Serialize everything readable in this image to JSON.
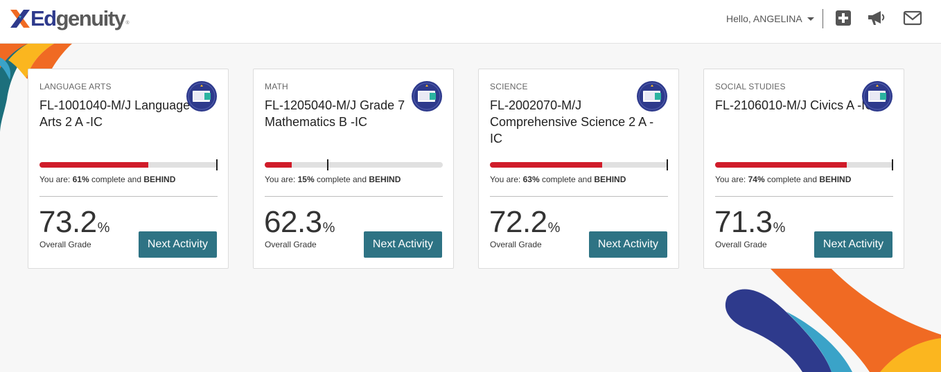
{
  "header": {
    "logo_text_ed": "Ed",
    "logo_text_rest": "genuity",
    "greeting": "Hello, ANGELINA",
    "icons": [
      "plus-square-icon",
      "megaphone-icon",
      "envelope-icon"
    ]
  },
  "colors": {
    "accent": "#2e7384",
    "progress_fill": "#d01c2a",
    "progress_track": "#e0e0e0",
    "badge": "#2e3a8c"
  },
  "courses": [
    {
      "subject": "LANGUAGE ARTS",
      "title": "FL-1001040-M/J Language Arts 2 A -IC",
      "progress_percent": 61,
      "target_percent": 100,
      "status_prefix": "You are: ",
      "status_percent": "61%",
      "status_mid": " complete and ",
      "status_state": "BEHIND",
      "grade": "73.2",
      "grade_unit": "%",
      "grade_label": "Overall Grade",
      "button_label": "Next Activity"
    },
    {
      "subject": "MATH",
      "title": "FL-1205040-M/J Grade 7 Mathematics B -IC",
      "progress_percent": 15,
      "target_percent": 35,
      "status_prefix": "You are: ",
      "status_percent": "15%",
      "status_mid": " complete and ",
      "status_state": "BEHIND",
      "grade": "62.3",
      "grade_unit": "%",
      "grade_label": "Overall Grade",
      "button_label": "Next Activity"
    },
    {
      "subject": "SCIENCE",
      "title": "FL-2002070-M/J Comprehensive Science 2 A -IC",
      "progress_percent": 63,
      "target_percent": 100,
      "status_prefix": "You are: ",
      "status_percent": "63%",
      "status_mid": " complete and ",
      "status_state": "BEHIND",
      "grade": "72.2",
      "grade_unit": "%",
      "grade_label": "Overall Grade",
      "button_label": "Next Activity"
    },
    {
      "subject": "SOCIAL STUDIES",
      "title": "FL-2106010-M/J Civics A -IC",
      "progress_percent": 74,
      "target_percent": 100,
      "status_prefix": "You are: ",
      "status_percent": "74%",
      "status_mid": " complete and ",
      "status_state": "BEHIND",
      "grade": "71.3",
      "grade_unit": "%",
      "grade_label": "Overall Grade",
      "button_label": "Next Activity"
    }
  ]
}
